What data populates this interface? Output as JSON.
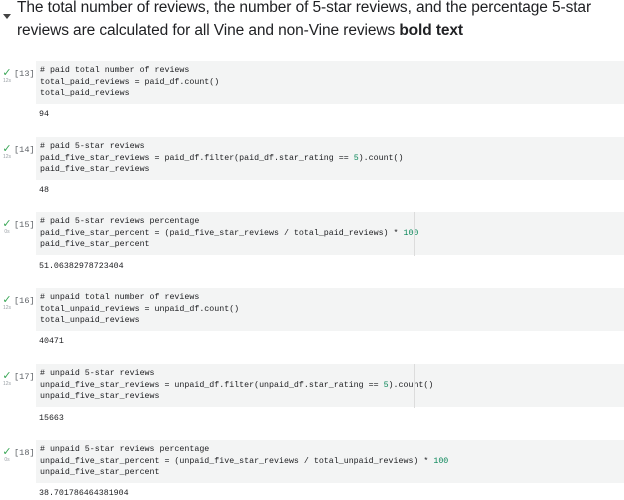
{
  "markdown": {
    "text_part1": "The total number of reviews, the number of 5-star reviews, and the percentage 5-star reviews are calculated for all Vine and non-Vine reviews ",
    "text_bold": "bold text"
  },
  "cells": [
    {
      "prompt": "[13]",
      "elapsed": "12s",
      "lines": [
        "# paid total number of reviews",
        "total_paid_reviews = paid_df.count()",
        "total_paid_reviews"
      ],
      "output": "94"
    },
    {
      "prompt": "[14]",
      "elapsed": "12s",
      "lines": [
        "# paid 5-star reviews",
        "paid_five_star_reviews = paid_df.filter(paid_df.star_rating == 5).count()",
        "paid_five_star_reviews"
      ],
      "output": "48"
    },
    {
      "prompt": "[15]",
      "elapsed": "0s",
      "lines": [
        "# paid 5-star reviews percentage",
        "paid_five_star_percent = (paid_five_star_reviews / total_paid_reviews) * 100",
        "paid_five_star_percent"
      ],
      "output": "51.06382978723404"
    },
    {
      "prompt": "[16]",
      "elapsed": "12s",
      "lines": [
        "# unpaid total number of reviews",
        "total_unpaid_reviews = unpaid_df.count()",
        "total_unpaid_reviews"
      ],
      "output": "40471"
    },
    {
      "prompt": "[17]",
      "elapsed": "12s",
      "lines": [
        "# unpaid 5-star reviews",
        "unpaid_five_star_reviews = unpaid_df.filter(unpaid_df.star_rating == 5).count()",
        "unpaid_five_star_reviews"
      ],
      "output": "15663"
    },
    {
      "prompt": "[18]",
      "elapsed": "0s",
      "lines": [
        "# unpaid 5-star reviews percentage",
        "unpaid_five_star_percent = (unpaid_five_star_reviews / total_unpaid_reviews) * 100",
        "unpaid_five_star_percent"
      ],
      "output": "38.701786464381904"
    }
  ],
  "status_icon": "check-icon",
  "colors": {
    "check": "#3aa757",
    "comment": "#0b7a0b",
    "number": "#098658",
    "code_bg": "#f3f4f4"
  }
}
